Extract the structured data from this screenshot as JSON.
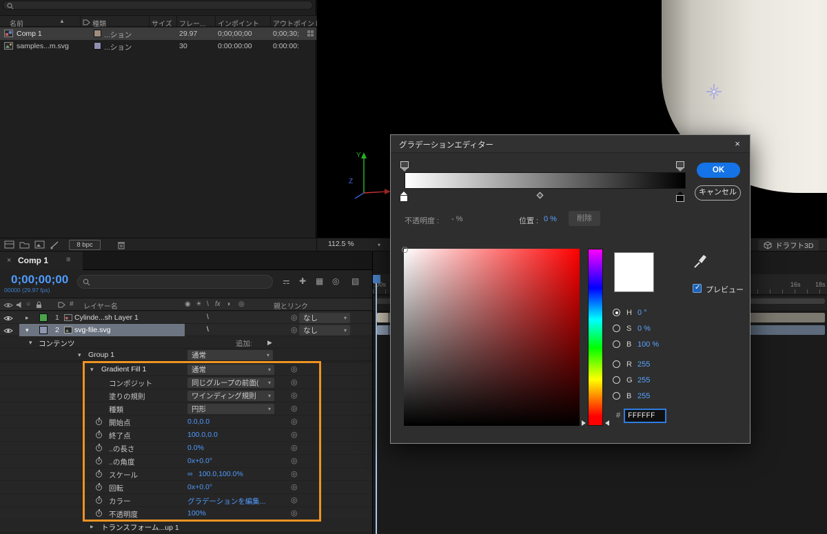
{
  "project": {
    "columns": {
      "name": "名前",
      "type": "種類",
      "size": "サイズ",
      "fps": "フレー...",
      "inpoint": "インポイント",
      "outpoint": "アウトポイント"
    },
    "rows": [
      {
        "name": "Comp 1",
        "type": "...ション",
        "fps": "29.97",
        "inpoint": "0;00;00;00",
        "outpoint": "0;00;30;"
      },
      {
        "name": "samples...m.svg",
        "type": "...ション",
        "fps": "30",
        "inpoint": "0:00:00:00",
        "outpoint": "0:00:00:"
      }
    ],
    "bpc": "8 bpc"
  },
  "viewer": {
    "zoom": "112.5 %",
    "draft3d": "ドラフト3D",
    "axis_y": "Y",
    "axis_z": "Z"
  },
  "dialog": {
    "title": "グラデーションエディター",
    "close": "×",
    "ok": "OK",
    "cancel": "キャンセル",
    "delete": "削除",
    "opacity_label": "不透明度 :",
    "opacity_value": "- %",
    "position_label": "位置 :",
    "position_value": "0 %",
    "preview_label": "プレビュー",
    "h_label": "H",
    "h_value": "0 °",
    "s_label": "S",
    "s_value": "0 %",
    "br_label": "B",
    "br_value": "100 %",
    "r_label": "R",
    "r_value": "255",
    "g_label": "G",
    "g_value": "255",
    "b_label": "B",
    "b_value": "255",
    "hex_prefix": "#",
    "hex_value": "FFFFFF"
  },
  "timeline": {
    "tab_close": "×",
    "tab_title": "Comp 1",
    "menu_icon": "≡",
    "timecode": "0;00;00;00",
    "frames": "00000 (29.97 fps)",
    "col_hash": "#",
    "col_layer": "レイヤー名",
    "col_parent": "親とリンク",
    "layers": [
      {
        "num": "1",
        "name": "Cylinde...sh Layer 1",
        "parent": "なし"
      },
      {
        "num": "2",
        "name": "svg-file.svg",
        "parent": "なし"
      }
    ],
    "contents": "コンテンツ",
    "add": "追加:",
    "group_name": "Group 1",
    "group_blend": "通常",
    "fill_name": "Gradient Fill 1",
    "fill_blend": "通常",
    "props": [
      {
        "label": "コンポジット",
        "value": "同じグループの前面("
      },
      {
        "label": "塗りの規則",
        "value": "ワインディング規則"
      },
      {
        "label": "種類",
        "value": "円形"
      },
      {
        "label": "開始点",
        "value": "0.0,0.0"
      },
      {
        "label": "終了点",
        "value": "100.0,0.0"
      },
      {
        "label": "..の長さ",
        "value": "0.0%"
      },
      {
        "label": "..の角度",
        "value": "0x+0.0°"
      },
      {
        "label": "スケール",
        "value": "100.0,100.0%"
      },
      {
        "label": "回転",
        "value": "0x+0.0°"
      },
      {
        "label": "カラー",
        "value": "グラデーションを編集..."
      },
      {
        "label": "不透明度",
        "value": "100%"
      }
    ],
    "transform": "トランスフォーム...up 1",
    "ruler_start": ":00s",
    "ruler_16": "16s",
    "ruler_18": "18s"
  }
}
